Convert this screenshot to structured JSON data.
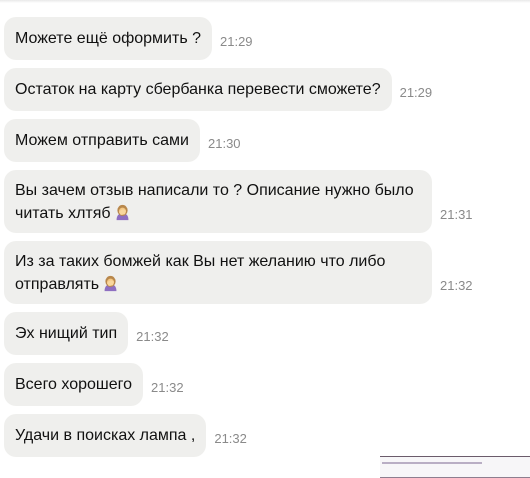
{
  "messages": [
    {
      "text": "Можете ещё оформить ?",
      "time": "21:29"
    },
    {
      "text": "Остаток на карту сбербанка перевести сможете?",
      "time": "21:29"
    },
    {
      "text": "Можем отправить сами",
      "time": "21:30"
    },
    {
      "line1": "Вы зачем отзыв написали то ? Описание нужно было",
      "line2": "читать хлтяб",
      "emoji": "woman-facepalming-emoji",
      "time": "21:31"
    },
    {
      "line1": "Из за таких бомжей как Вы нет желанию что либо",
      "line2": "отправлять",
      "emoji": "woman-facepalming-emoji",
      "time": "21:32"
    },
    {
      "text": "Эх нищий тип",
      "time": "21:32"
    },
    {
      "text": "Всего хорошего",
      "time": "21:32"
    },
    {
      "text": "Удачи в поисках лампа ,",
      "time": "21:32"
    }
  ],
  "colors": {
    "bubble": "#efefed",
    "text": "#111111",
    "time": "#8a8a8a"
  }
}
